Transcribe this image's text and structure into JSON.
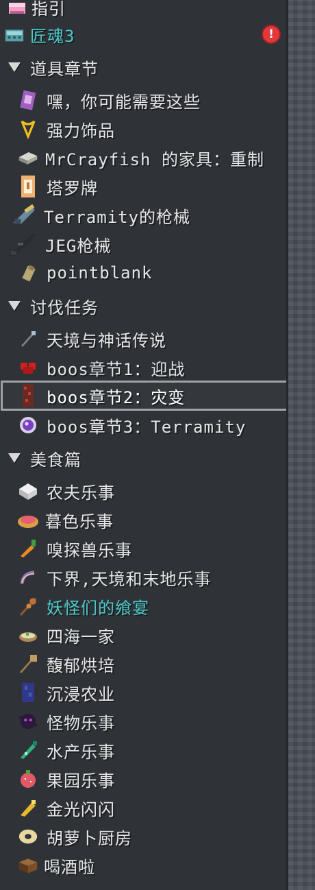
{
  "top_items": [
    {
      "label": "指引",
      "icon": "pink-book-icon"
    },
    {
      "label": "匠魂3",
      "icon": "tinkers-book-icon"
    }
  ],
  "warning_badge": "!",
  "categories": [
    {
      "label": "道具章节",
      "items": [
        {
          "label": "嘿，你可能需要这些",
          "icon": "purple-scroll-icon"
        },
        {
          "label": "强力饰品",
          "icon": "gold-amulet-icon"
        },
        {
          "label": "MrCrayfish 的家具：重制",
          "icon": "furniture-icon"
        },
        {
          "label": "塔罗牌",
          "icon": "tarot-card-icon"
        },
        {
          "label": "Terramity的枪械",
          "icon": "blaster-gun-icon"
        },
        {
          "label": "JEG枪械",
          "icon": "rifle-icon"
        },
        {
          "label": "pointblank",
          "icon": "ammo-icon"
        }
      ]
    },
    {
      "label": "讨伐任务",
      "items": [
        {
          "label": "天境与神话传说",
          "icon": "staff-icon"
        },
        {
          "label": "boos章节1：迎战",
          "icon": "red-heart-icon"
        },
        {
          "label": "boos章节2：灾变",
          "icon": "netherrack-pillar-icon",
          "selected": true
        },
        {
          "label": "boos章节3：Terramity",
          "icon": "purple-orb-icon"
        }
      ]
    },
    {
      "label": "美食篇",
      "items": [
        {
          "label": "农夫乐事",
          "icon": "white-block-icon"
        },
        {
          "label": "暮色乐事",
          "icon": "pie-icon"
        },
        {
          "label": "嗅探兽乐事",
          "icon": "carrot-icon"
        },
        {
          "label": "下界,天境和末地乐事",
          "icon": "shrimp-icon"
        },
        {
          "label": "妖怪们的飨宴",
          "icon": "skewer-icon",
          "cyan": true
        },
        {
          "label": "四海一家",
          "icon": "bowl-icon"
        },
        {
          "label": "馥郁烘培",
          "icon": "baking-peel-icon"
        },
        {
          "label": "沉浸农业",
          "icon": "blue-crop-icon"
        },
        {
          "label": "怪物乐事",
          "icon": "shadow-creature-icon"
        },
        {
          "label": "水产乐事",
          "icon": "green-fish-icon"
        },
        {
          "label": "果园乐事",
          "icon": "berry-icon"
        },
        {
          "label": "金光闪闪",
          "icon": "golden-item-icon"
        },
        {
          "label": "胡萝卜厨房",
          "icon": "donut-icon"
        },
        {
          "label": "喝酒啦",
          "icon": "barrel-icon"
        }
      ]
    }
  ],
  "colors": {
    "panel": "#2f3338",
    "text": "#e6e6e6",
    "accent": "#4cc8c8",
    "warn": "#e0393b",
    "selection_outline": "#a0a4a8"
  }
}
